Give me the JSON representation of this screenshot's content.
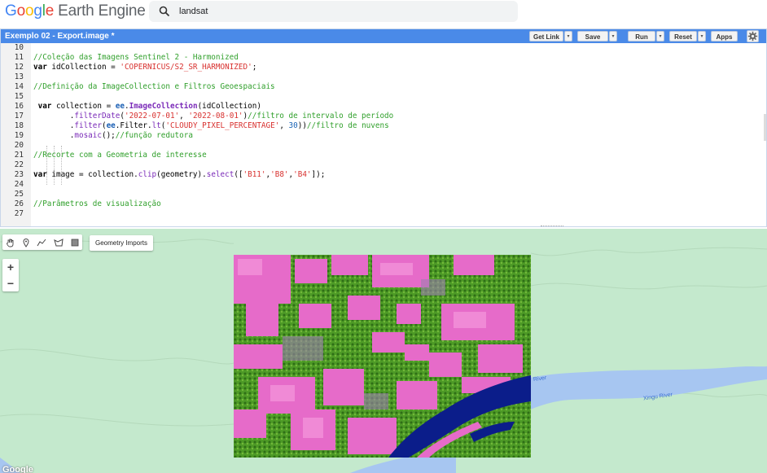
{
  "header": {
    "logo_google": [
      "G",
      "o",
      "o",
      "g",
      "l",
      "e"
    ],
    "logo_product": "Earth Engine",
    "search": {
      "value": "landsat",
      "icon": "search-icon"
    }
  },
  "editor": {
    "title": "Exemplo 02 - Export.image *",
    "toolbar": {
      "get_link": "Get Link",
      "save": "Save",
      "run": "Run",
      "reset": "Reset",
      "apps": "Apps",
      "dropdown": "▾",
      "settings_icon": "gear-icon"
    },
    "lines": [
      {
        "num": "10",
        "text": ""
      },
      {
        "num": "11",
        "text": "//Coleção das Imagens Sentinel 2 - Harmonized"
      },
      {
        "num": "12",
        "text": "var idCollection = 'COPERNICUS/S2_SR_HARMONIZED';"
      },
      {
        "num": "13",
        "text": ""
      },
      {
        "num": "14",
        "text": "//Definição da ImageCollection e Filtros Geoespaciais"
      },
      {
        "num": "15",
        "text": ""
      },
      {
        "num": "16",
        "text": " var collection = ee.ImageCollection(idCollection)"
      },
      {
        "num": "17",
        "text": "        .filterDate('2022-07-01', '2022-08-01')//filtro de intervalo de período"
      },
      {
        "num": "18",
        "text": "        .filter(ee.Filter.lt('CLOUDY_PIXEL_PERCENTAGE', 30))//filtro de nuvens"
      },
      {
        "num": "19",
        "text": "        .mosaic();//função redutora"
      },
      {
        "num": "20",
        "text": ""
      },
      {
        "num": "21",
        "text": "//Recorte com a Geometria de interesse"
      },
      {
        "num": "22",
        "text": ""
      },
      {
        "num": "23",
        "text": "var image = collection.clip(geometry).select(['B11','B8','B4']);"
      },
      {
        "num": "24",
        "text": ""
      },
      {
        "num": "25",
        "text": ""
      },
      {
        "num": "26",
        "text": "//Parâmetros de visualização"
      },
      {
        "num": "27",
        "text": ""
      }
    ]
  },
  "map": {
    "drawing_tools": [
      "hand-icon",
      "point-marker-icon",
      "line-icon",
      "polygon-icon",
      "rectangle-icon"
    ],
    "geometry_imports": "Geometry Imports",
    "zoom_in": "+",
    "zoom_out": "−",
    "river_labels": [
      "River",
      "Xingu River"
    ],
    "attribution": "Google"
  },
  "colors": {
    "accent": "#4a8ae8",
    "map_background": "#c4e9cd",
    "river": "#a7c6f1",
    "comment": "#31a02c",
    "string": "#d8312f",
    "function": "#7a2ab8",
    "number": "#1a64b5"
  }
}
